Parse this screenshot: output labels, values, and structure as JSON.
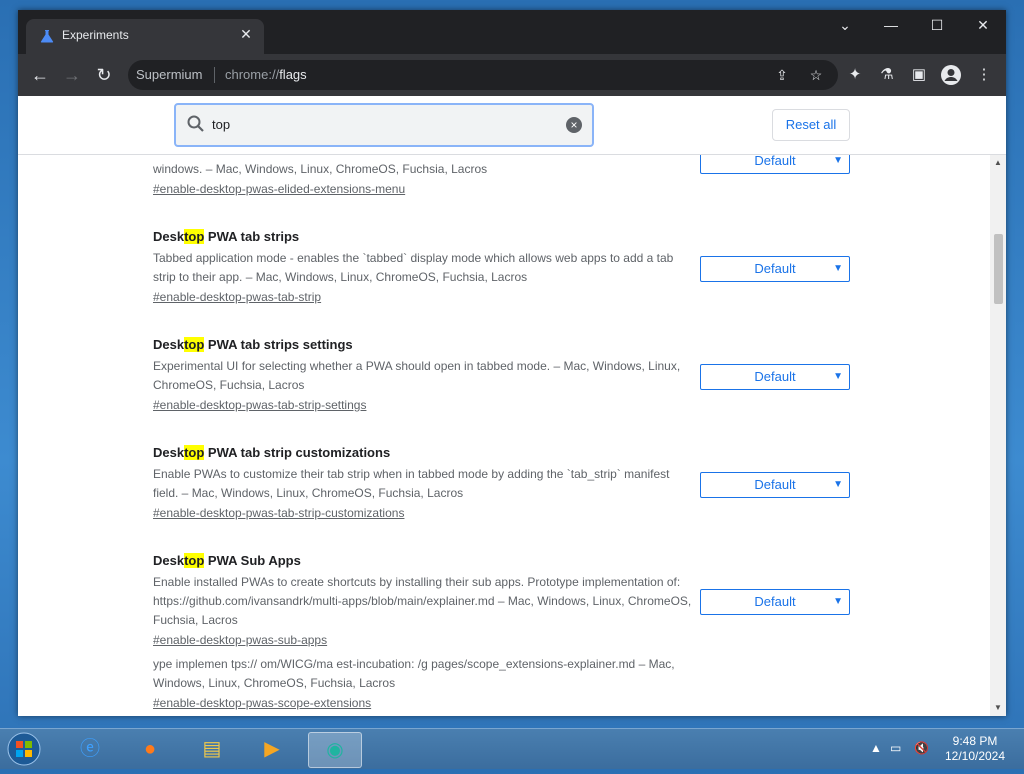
{
  "browser": {
    "tab_title": "Experiments",
    "omnibox_site": "Supermium",
    "omnibox_scheme": "chrome://",
    "omnibox_path": "flags"
  },
  "header": {
    "search_value": "top",
    "reset_label": "Reset all"
  },
  "experiments": [
    {
      "title_pre": "",
      "title_hl": "",
      "title_post": "",
      "desc": "windows. – Mac, Windows, Linux, ChromeOS, Fuchsia, Lacros",
      "link": "#enable-desktop-pwas-elided-extensions-menu",
      "select": "Default"
    },
    {
      "title_pre": "Desk",
      "title_hl": "top",
      "title_post": " PWA tab strips",
      "desc": "Tabbed application mode - enables the `tabbed` display mode which allows web apps to add a tab strip to their app. – Mac, Windows, Linux, ChromeOS, Fuchsia, Lacros",
      "link": "#enable-desktop-pwas-tab-strip",
      "select": "Default"
    },
    {
      "title_pre": "Desk",
      "title_hl": "top",
      "title_post": " PWA tab strips settings",
      "desc": "Experimental UI for selecting whether a PWA should open in tabbed mode. – Mac, Windows, Linux, ChromeOS, Fuchsia, Lacros",
      "link": "#enable-desktop-pwas-tab-strip-settings",
      "select": "Default"
    },
    {
      "title_pre": "Desk",
      "title_hl": "top",
      "title_post": " PWA tab strip customizations",
      "desc": "Enable PWAs to customize their tab strip when in tabbed mode by adding the `tab_strip` manifest field. – Mac, Windows, Linux, ChromeOS, Fuchsia, Lacros",
      "link": "#enable-desktop-pwas-tab-strip-customizations",
      "select": "Default"
    },
    {
      "title_pre": "Desk",
      "title_hl": "top",
      "title_post": " PWA Sub Apps",
      "desc": "Enable installed PWAs to create shortcuts by installing their sub apps. Prototype implementation of: https://github.com/ivansandrk/multi-apps/blob/main/explainer.md – Mac, Windows, Linux, ChromeOS, Fuchsia, Lacros",
      "link": "#enable-desktop-pwas-sub-apps",
      "select": "Default"
    },
    {
      "title_pre": "",
      "title_hl": "",
      "title_post": "",
      "desc": "ype implemen tps:// om/WICG/ma est-incubation: /g pages/scope_extensions-explainer.md – Mac, Windows, Linux, ChromeOS, Fuchsia, Lacros",
      "link": "#enable-desktop-pwas-scope-extensions",
      "select": ""
    }
  ],
  "taskbar": {
    "time": "9:48 PM",
    "date": "12/10/2024"
  },
  "colors": {
    "accent": "#1a73e8",
    "highlight": "#ffff00",
    "chrome_dark": "#202124"
  }
}
